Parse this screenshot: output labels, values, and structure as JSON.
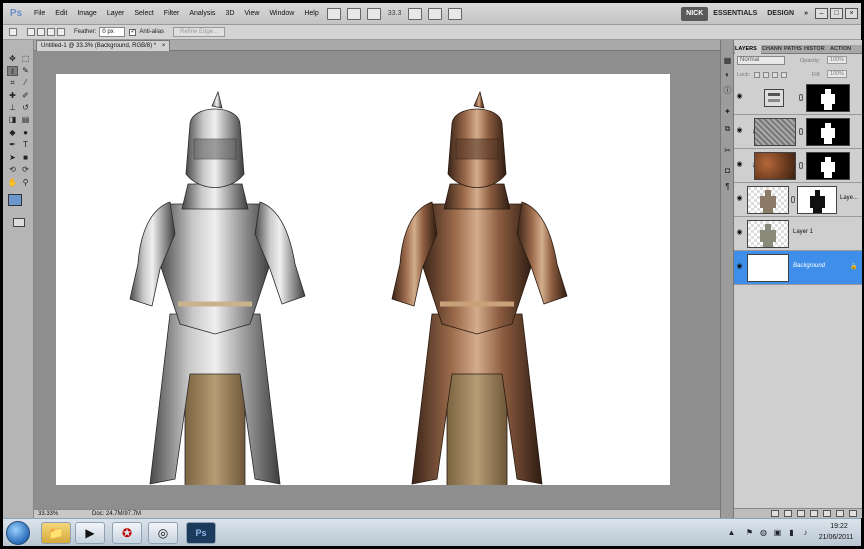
{
  "app": {
    "logo": "Ps",
    "menu": [
      "File",
      "Edit",
      "Image",
      "Layer",
      "Select",
      "Filter",
      "Analysis",
      "3D",
      "View",
      "Window",
      "Help"
    ],
    "zoom_display": "33.3",
    "workspaces": [
      "NICK",
      "ESSENTIALS",
      "DESIGN"
    ],
    "more_workspaces": "»",
    "window_controls": [
      "–",
      "□",
      "×"
    ]
  },
  "options": {
    "feather_label": "Feather:",
    "feather_value": "0 px",
    "antialias_label": "Anti-alias",
    "antialias_checked": "✓",
    "refine_edge": "Refine Edge..."
  },
  "document": {
    "tab_title": "Untitled-1 @ 33.3% (Background, RGB/8) *",
    "tab_close": "×",
    "zoom_status": "33.33%",
    "doc_size": "Doc: 24.7M/97.7M"
  },
  "colors": {
    "foreground": "#6a96cc",
    "background": "#ffffff",
    "selection": "#3f8fea",
    "canvas_surround": "#8e8e8e"
  },
  "layers_panel": {
    "tabs": [
      "LAYERS",
      "CHANN",
      "PATHS",
      "HISTOR",
      "ACTION"
    ],
    "blend_mode": "Normal",
    "opacity_label": "Opacity:",
    "opacity_value": "100%",
    "lock_label": "Lock:",
    "fill_label": "Fill:",
    "fill_value": "100%",
    "layers": [
      {
        "name": "",
        "type": "adjustment",
        "visible": true
      },
      {
        "name": "",
        "type": "texture-metal",
        "visible": true
      },
      {
        "name": "",
        "type": "texture-rust",
        "visible": true
      },
      {
        "name": "Laye...",
        "type": "armor-masked",
        "visible": true
      },
      {
        "name": "Layer 1",
        "type": "armor",
        "visible": true
      },
      {
        "name": "Background",
        "type": "white",
        "visible": true,
        "selected": true
      }
    ]
  },
  "taskbar": {
    "items": [
      "explorer",
      "media-player",
      "acrobat",
      "chrome",
      "photoshop"
    ],
    "time": "19:22",
    "date": "21/06/2011"
  }
}
